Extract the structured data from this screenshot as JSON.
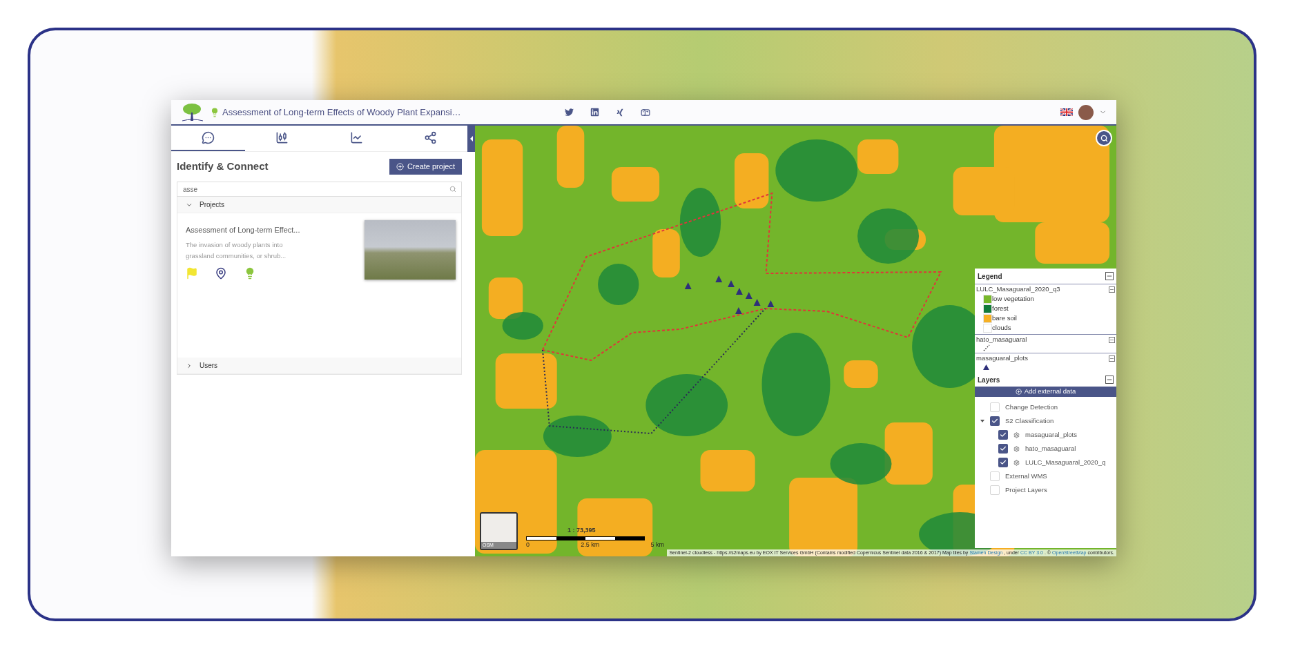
{
  "header": {
    "title": "Assessment of Long-term Effects of Woody Plant Expansi…"
  },
  "tabs": [
    {
      "kind": "chat",
      "selected": true
    },
    {
      "kind": "filters",
      "selected": false
    },
    {
      "kind": "chart",
      "selected": false
    },
    {
      "kind": "share",
      "selected": false
    }
  ],
  "panel": {
    "title": "Identify & Connect",
    "create_button": "Create project",
    "search": {
      "value": "asse"
    },
    "sections": [
      {
        "label": "Projects",
        "expanded": true,
        "items": [
          {
            "title": "Assessment of Long-term Effect...",
            "description": "The invasion of woody plants into grassland communities, or shrub..."
          }
        ]
      },
      {
        "label": "Users",
        "expanded": false
      }
    ]
  },
  "map": {
    "minimap_label": "OSM",
    "scale": {
      "ratio": "1 : 73,395",
      "ticks": [
        "0",
        "2.5 km",
        "5 km"
      ]
    },
    "attribution": [
      {
        "kind": "text",
        "text": "Sentinel-2 cloudless - https://s2maps.eu by EOX IT Services GmbH (Contains modified Copernicus Sentinel data 2016 & 2017) Map tiles by"
      },
      {
        "kind": "link",
        "text": "Stamen Design"
      },
      {
        "kind": "text",
        "text": ", under"
      },
      {
        "kind": "link",
        "text": "CC BY 3.0"
      },
      {
        "kind": "text",
        "text": ". ©"
      },
      {
        "kind": "link",
        "text": "OpenStreetMap"
      },
      {
        "kind": "text",
        "text": "contributors."
      }
    ]
  },
  "legend": {
    "title": "Legend",
    "groups": [
      {
        "name": "LULC_Masaguaral_2020_q3",
        "kind": "classes",
        "entries": [
          {
            "label": "low vegetation",
            "color": "#78b82a"
          },
          {
            "label": "forest",
            "color": "#117a3a"
          },
          {
            "label": "bare soil",
            "color": "#f6b024"
          },
          {
            "label": "clouds",
            "color": "#ffffff"
          }
        ]
      },
      {
        "name": "hato_masaguaral",
        "kind": "line"
      },
      {
        "name": "masaguaral_plots",
        "kind": "triangle"
      }
    ]
  },
  "layers": {
    "title": "Layers",
    "add_button": "Add external data",
    "items": [
      {
        "label": "Change Detection",
        "checked": false
      },
      {
        "label": "S2 Classification",
        "checked": true,
        "expanded": true,
        "children": [
          {
            "label": "masaguaral_plots",
            "checked": true
          },
          {
            "label": "hato_masaguaral",
            "checked": true
          },
          {
            "label": "LULC_Masaguaral_2020_q",
            "checked": true
          }
        ]
      },
      {
        "label": "External WMS",
        "checked": false
      },
      {
        "label": "Project Layers",
        "checked": false
      }
    ]
  }
}
